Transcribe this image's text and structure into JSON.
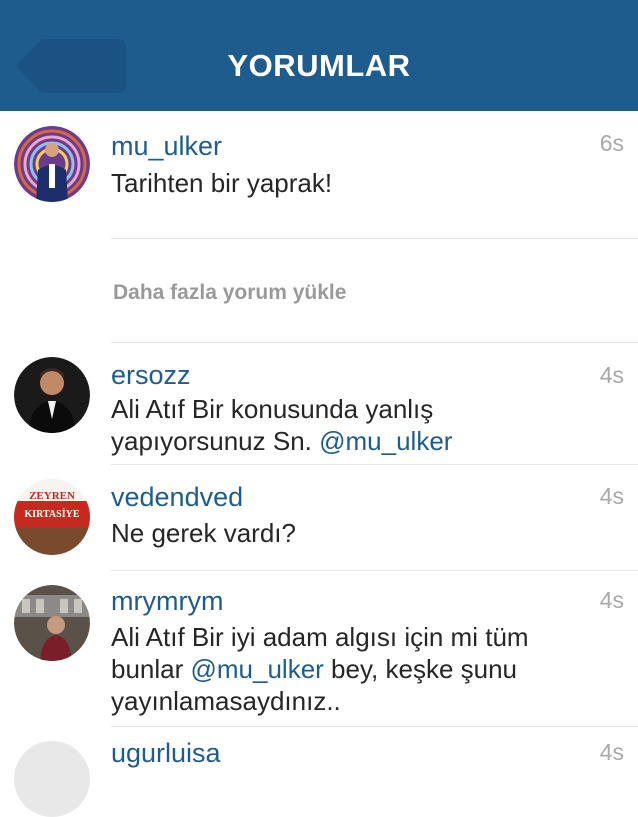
{
  "header": {
    "title": "YORUMLAR",
    "back_icon": "back-arrow-icon",
    "background": "#1f5c8e"
  },
  "caption": {
    "username": "mu_ulker",
    "time": "6s",
    "text": "Tarihten bir yaprak!"
  },
  "load_more": "Daha fazla yorum yükle",
  "comments": [
    {
      "username": "ersozz",
      "time": "4s",
      "text_before": "Ali Atıf Bir konusunda yanlış yapıyorsunuz Sn. ",
      "mention": "@mu_ulker",
      "text_after": ""
    },
    {
      "username": "vedendved",
      "time": "4s",
      "text": "Ne gerek vardı?",
      "avatar_lines": [
        "ZEYREN",
        "KIRTASİYE"
      ]
    },
    {
      "username": "mrymrym",
      "time": "4s",
      "text_before": "Ali Atıf Bir iyi adam algısı için mi tüm bunlar ",
      "mention": "@mu_ulker",
      "text_after": " bey, keşke şunu yayınlamasaydınız.."
    },
    {
      "username": "ugurluisa",
      "time": "4s"
    }
  ],
  "colors": {
    "link": "#1f5c8e",
    "meta": "#a8a8a8",
    "text": "#262626"
  }
}
